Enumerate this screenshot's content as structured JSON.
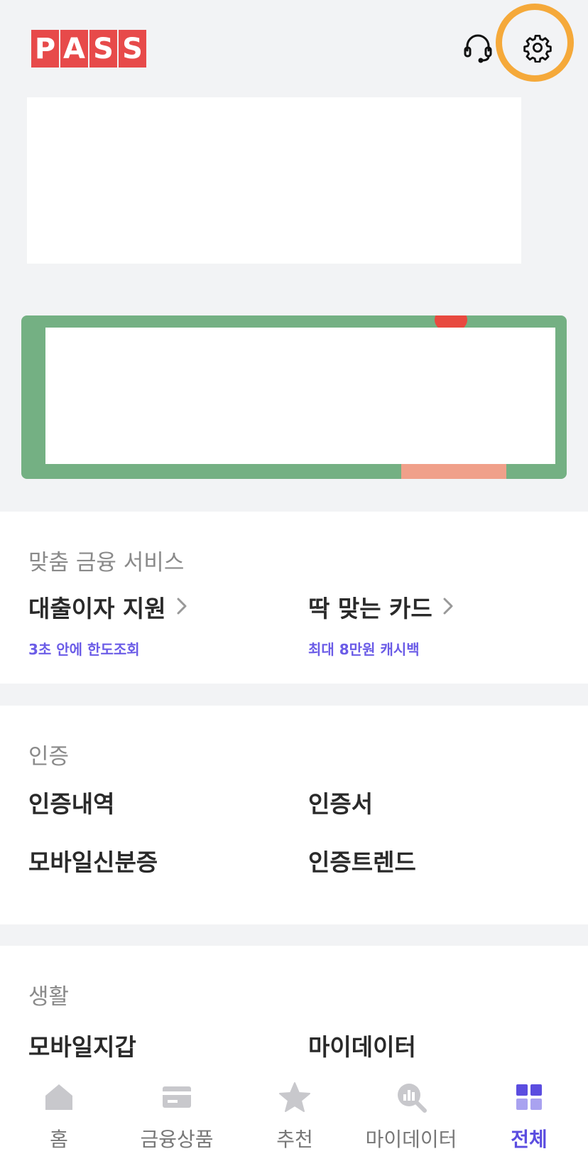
{
  "header": {
    "logo_letters": [
      "P",
      "A",
      "S",
      "S"
    ],
    "headset_icon": "headset-icon",
    "settings_icon": "gear-icon",
    "colors": {
      "logo": "#e74a4a",
      "highlight": "#f5a93a"
    }
  },
  "sections": {
    "finance": {
      "title": "맞춤 금융 서비스",
      "items": [
        {
          "label": "대출이자 지원",
          "sub": "3초 안에 한도조회"
        },
        {
          "label": "딱 맞는 카드",
          "sub": "최대 8만원 캐시백"
        }
      ]
    },
    "auth": {
      "title": "인증",
      "items": [
        "인증내역",
        "인증서",
        "모바일신분증",
        "인증트렌드"
      ]
    },
    "life": {
      "title": "생활",
      "items": [
        "모바일지갑",
        "마이데이터"
      ]
    }
  },
  "tabbar": {
    "tabs": [
      {
        "label": "홈",
        "icon": "home-icon"
      },
      {
        "label": "금융상품",
        "icon": "card-icon"
      },
      {
        "label": "추천",
        "icon": "star-icon"
      },
      {
        "label": "마이데이터",
        "icon": "chart-search-icon"
      },
      {
        "label": "전체",
        "icon": "grid-icon",
        "active": true
      }
    ],
    "colors": {
      "active": "#5b4de0",
      "inactive": "#777777"
    }
  }
}
